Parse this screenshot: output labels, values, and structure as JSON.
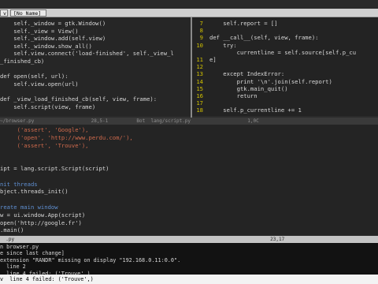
{
  "tabs": [
    "v",
    "[No Name]"
  ],
  "left_pane": [
    "    self._window = gtk.Window()",
    "    self._view = View()",
    "    self._window.add(self.view)",
    "    self._window.show_all()",
    "    self.view.connect('load-finished', self._view_l",
    "_finished_cb)",
    "",
    "def open(self, url):",
    "    self.view.open(url)",
    "",
    "def _view_load_finished_cb(self, view, frame):",
    "    self.script(view, frame)"
  ],
  "right_pane": {
    "numbers": [
      "7",
      "8",
      "9",
      "10",
      "",
      "11",
      "12",
      "13",
      "14",
      "15",
      "16",
      "17",
      "18"
    ],
    "lines": [
      "    self.report = []",
      "",
      "def __call__(self, view, frame):",
      "    try:",
      "        currentline = self.source[self.p_cu",
      "e]",
      "",
      "    except IndexError:",
      "        print '\\n'.join(self.report)",
      "        gtk.main_quit()",
      "        return",
      "",
      "    self.p_currentline += 1"
    ]
  },
  "status_top": "~/browser.py                    28,5-1          Bot  lang/script.py                    1,0C",
  "bottom_pane": [
    "     ('assert', 'Google'),",
    "     ('open', 'http://www.perdu.com/'),",
    "     ('assert', 'Trouve'),",
    "",
    "",
    "ipt = lang.script.Script(script)",
    "",
    "nit threads",
    "bject.threads_init()",
    "",
    "reate main window",
    "w = ui.window.App(script)",
    "open('http://google.fr')",
    ".main()"
  ],
  "status_bottom": "  .py                                                                                          23,17",
  "cmd_lines": [
    "n browser.py",
    "e since last change]",
    "extension \"RANDR\" missing on display \"192.168.0.11:0.0\".",
    "  line 2",
    "  line 4 failed: ('Trouve',)"
  ],
  "last_line": "v  line 4 failed: ('Trouve',)"
}
